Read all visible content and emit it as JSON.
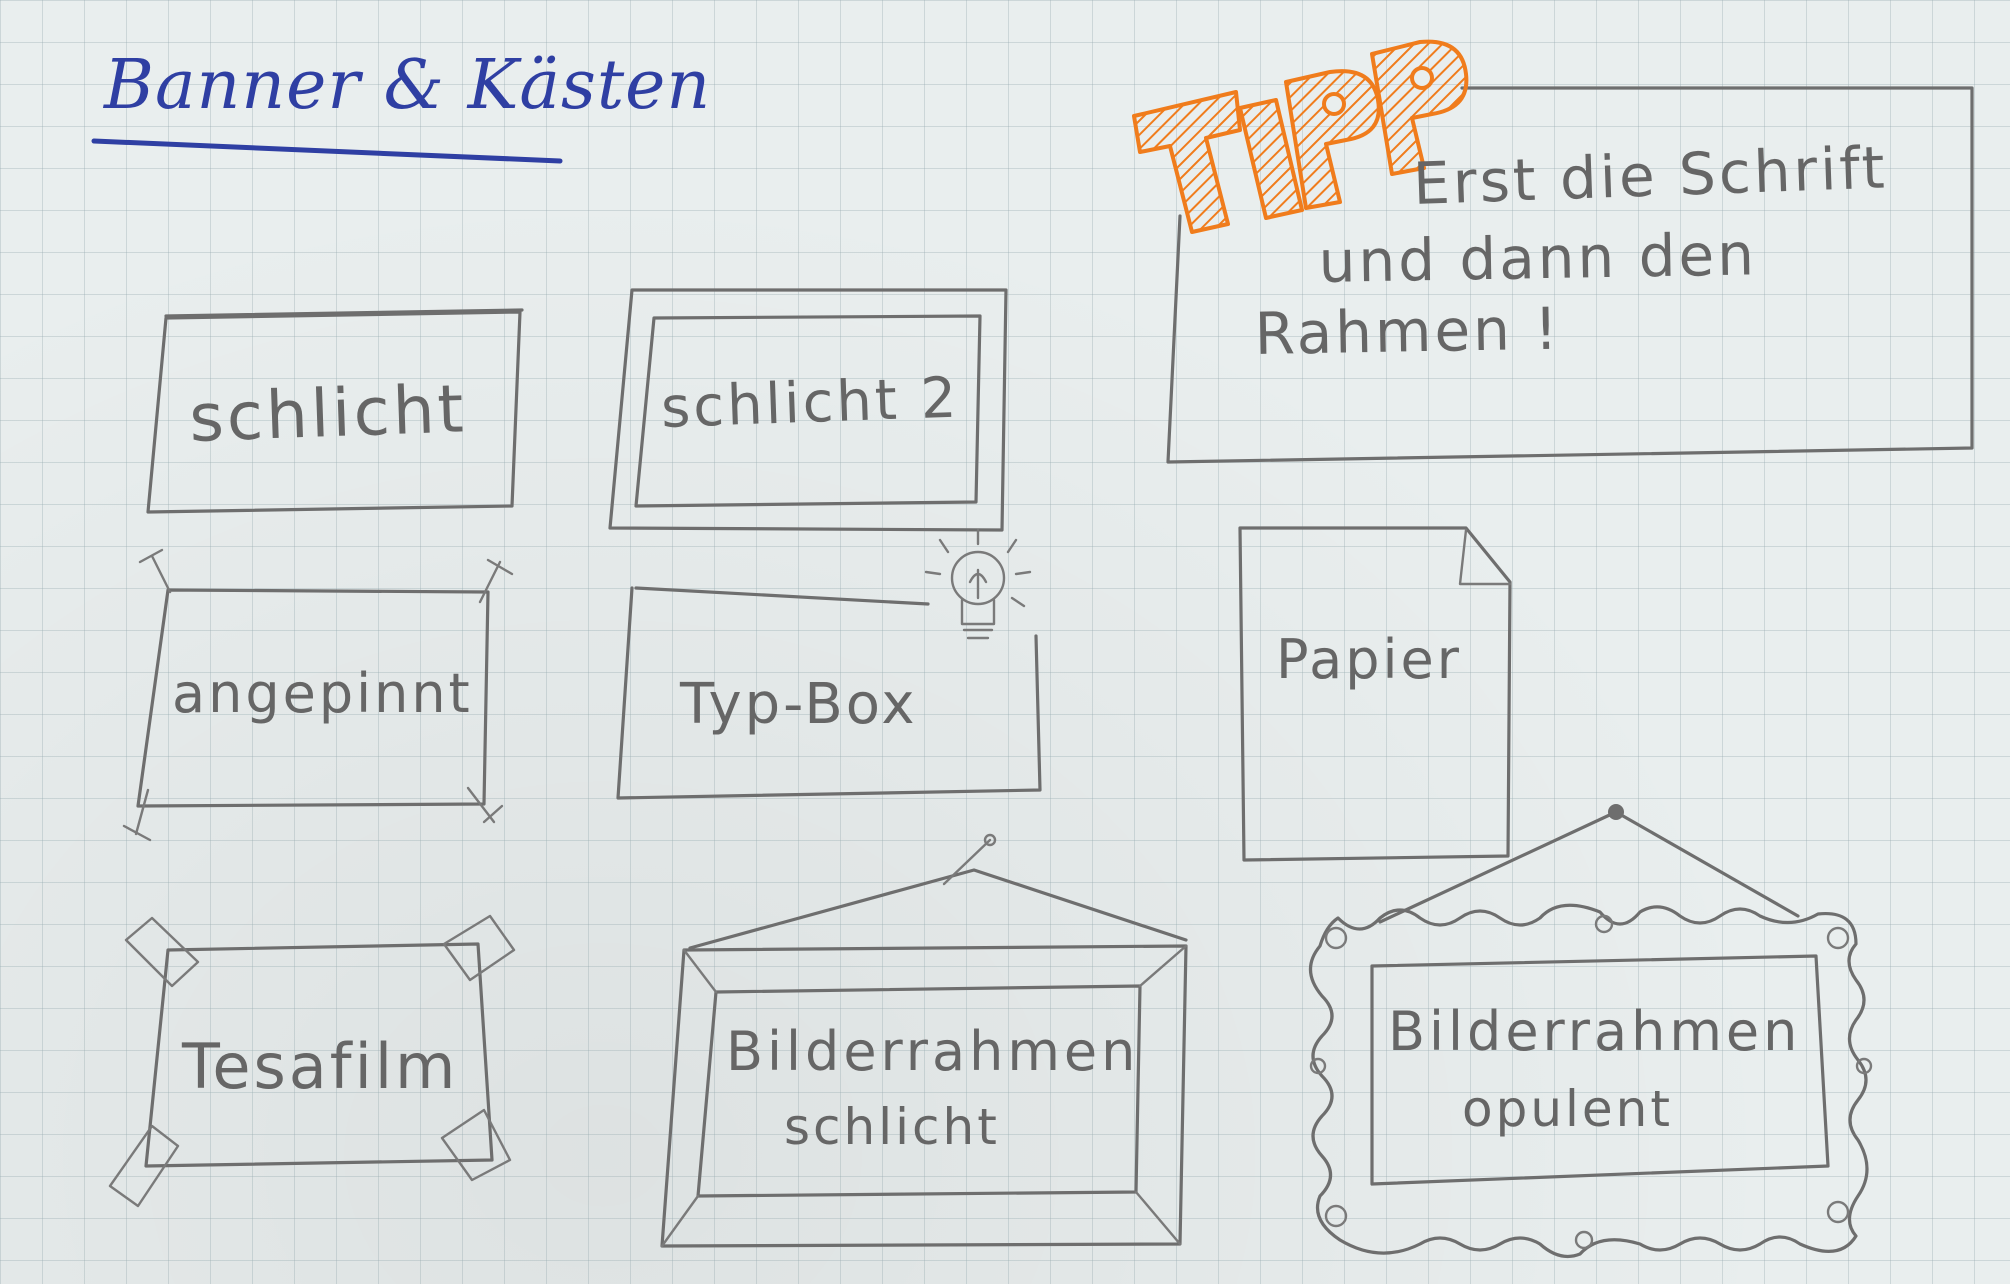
{
  "page_title": "Banner & Kästen",
  "tip": {
    "heading": "TIPP",
    "line1": "Erst die Schrift",
    "line2": "und dann den",
    "line3": "Rahmen !"
  },
  "boxes": {
    "schlicht": "schlicht",
    "schlicht2": "schlicht 2",
    "angepinnt": "angepinnt",
    "typbox": "Typ-Box",
    "papier": "Papier",
    "tesafilm": "Tesafilm",
    "bilder_schlicht_line1": "Bilderrahmen",
    "bilder_schlicht_line2": "schlicht",
    "bilder_opulent_line1": "Bilderrahmen",
    "bilder_opulent_line2": "opulent"
  },
  "colors": {
    "paper": "#e9eeee",
    "pencil": "#6e6e6e",
    "title_ink": "#2f3fa3",
    "tip_orange": "#f07c1c"
  },
  "icons": [
    "lightbulb-icon",
    "pin-icon",
    "tape-icon",
    "nail-icon"
  ]
}
